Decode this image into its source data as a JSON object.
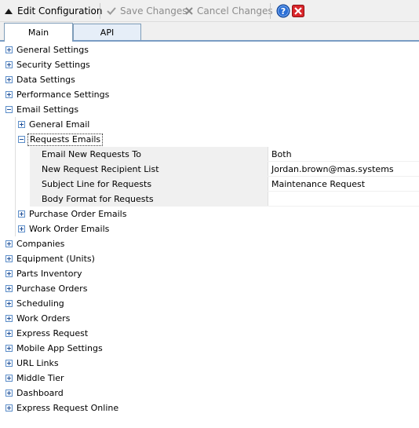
{
  "toolbar": {
    "edit_label": "Edit Configuration",
    "save_label": "Save Changes",
    "cancel_label": "Cancel Changes",
    "help_icon": "help-icon",
    "close_icon": "close-icon"
  },
  "tabs": [
    {
      "label": "Main",
      "active": true
    },
    {
      "label": "API",
      "active": false
    }
  ],
  "tree": {
    "general_settings": "General Settings",
    "security_settings": "Security Settings",
    "data_settings": "Data Settings",
    "performance_settings": "Performance Settings",
    "email_settings": "Email Settings",
    "email": {
      "general_email": "General Email",
      "requests_emails": "Requests Emails",
      "properties": [
        {
          "name": "Email New Requests To",
          "value": "Both"
        },
        {
          "name": "New Request Recipient List",
          "value": "Jordan.brown@mas.systems"
        },
        {
          "name": "Subject Line for Requests",
          "value": "Maintenance Request"
        },
        {
          "name": "Body Format for Requests",
          "value": ""
        }
      ],
      "purchase_order_emails": "Purchase Order Emails",
      "work_order_emails": "Work Order Emails"
    },
    "companies": "Companies",
    "equipment": "Equipment (Units)",
    "parts_inventory": "Parts Inventory",
    "purchase_orders": "Purchase Orders",
    "scheduling": "Scheduling",
    "work_orders": "Work Orders",
    "express_request": "Express Request",
    "mobile_app_settings": "Mobile App Settings",
    "url_links": "URL Links",
    "middle_tier": "Middle Tier",
    "dashboard": "Dashboard",
    "express_request_online": "Express Request Online"
  },
  "colors": {
    "expander_border": "#5b8dc9",
    "tab_accent": "#7a9cc4",
    "property_name_bg": "#f0f0f0"
  }
}
